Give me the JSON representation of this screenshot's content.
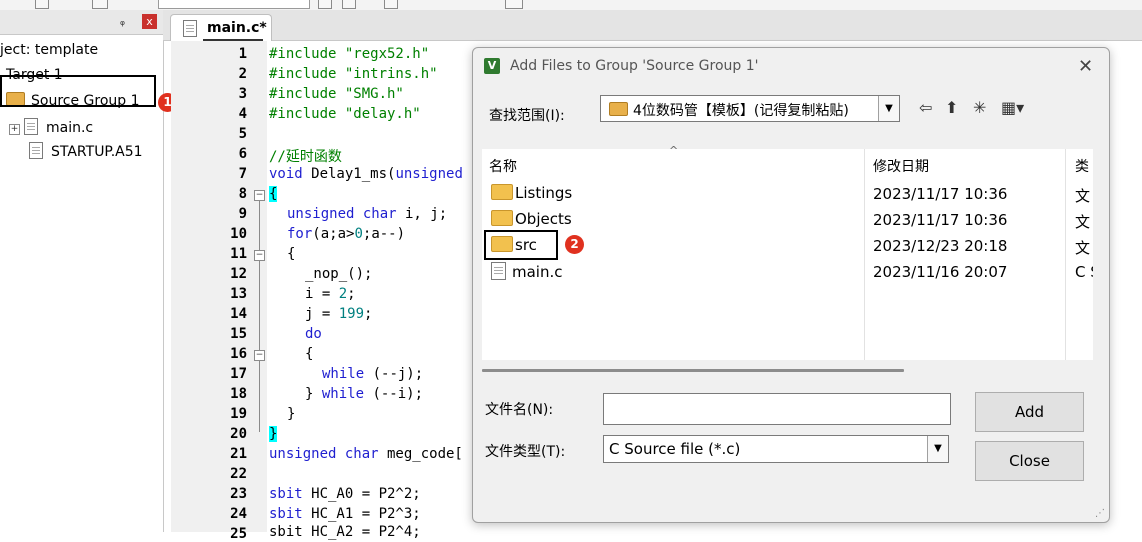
{
  "project_panel": {
    "pin_glyph": "ᵩ",
    "close_glyph": "x",
    "project_label": "ject: template",
    "target_label": "Target 1",
    "source_group_label": "Source Group 1",
    "files": [
      "main.c",
      "STARTUP.A51"
    ],
    "expand_glyph": "+",
    "badge_1": "1"
  },
  "editor": {
    "tab_label": "main.c*",
    "line_numbers": [
      "1",
      "2",
      "3",
      "4",
      "5",
      "6",
      "7",
      "8",
      "9",
      "10",
      "11",
      "12",
      "13",
      "14",
      "15",
      "16",
      "17",
      "18",
      "19",
      "20",
      "21",
      "22",
      "23",
      "24",
      "25"
    ],
    "lines": {
      "l1": "#include \"regx52.h\"",
      "l2": "#include \"intrins.h\"",
      "l3": "#include \"SMG.h\"",
      "l4": "#include \"delay.h\"",
      "l6": "//延时函数",
      "l7a": "void",
      "l7b": " Delay1_ms(",
      "l7c": "unsigned",
      "l8": "{",
      "l9a": "unsigned char",
      "l9b": " i, j;",
      "l10a": "for",
      "l10b": "(a;a>",
      "l10c": "0",
      "l10d": ";a--)",
      "l11": "{",
      "l12": "_nop_();",
      "l13a": "i = ",
      "l13b": "2",
      "l13c": ";",
      "l14a": "j = ",
      "l14b": "199",
      "l14c": ";",
      "l15": "do",
      "l16": "{",
      "l17a": "while",
      "l17b": " (--j);",
      "l18a": "} ",
      "l18b": "while",
      "l18c": " (--i);",
      "l19": "}",
      "l20": "}",
      "l21a": "unsigned char",
      "l21b": " meg_code[",
      "l23a": "sbit",
      "l23b": " HC_A0 = P2^2;",
      "l24a": "sbit",
      "l24b": " HC_A1 = P2^3;",
      "l25": "sbit HC_A2 = P2^4;"
    }
  },
  "dialog": {
    "icon_letter": "V",
    "title": "Add Files to Group 'Source Group 1'",
    "close_glyph": "✕",
    "look_in_label": "查找范围(I):",
    "look_in_value": "4位数码管【模板】(记得复制粘贴)",
    "combo_arrow": "▼",
    "nav_back": "⇦",
    "nav_up": "⬆",
    "nav_new": "✳",
    "nav_view": "▦▾",
    "sort_caret": "^",
    "columns": {
      "name": "名称",
      "date": "修改日期",
      "type": "类"
    },
    "rows": [
      {
        "name": "Listings",
        "date": "2023/11/17 10:36",
        "type": "文"
      },
      {
        "name": "Objects",
        "date": "2023/11/17 10:36",
        "type": "文"
      },
      {
        "name": "src",
        "date": "2023/12/23 20:18",
        "type": "文"
      },
      {
        "name": "main.c",
        "date": "2023/11/16 20:07",
        "type": "C S"
      }
    ],
    "badge_2": "2",
    "file_name_label": "文件名(N):",
    "file_name_value": "",
    "file_type_label": "文件类型(T):",
    "file_type_value": "C Source file (*.c)",
    "add_button": "Add",
    "close_button": "Close",
    "grip_glyph": "⋰"
  }
}
